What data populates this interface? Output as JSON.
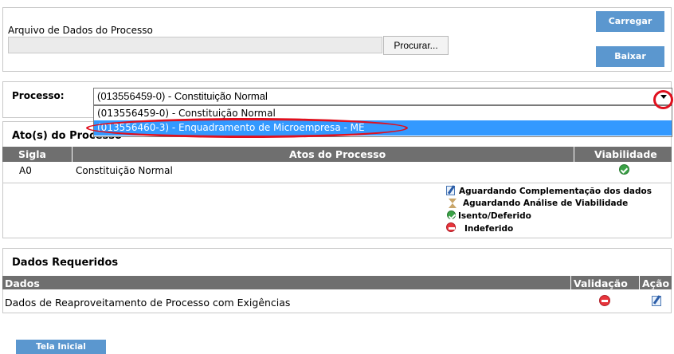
{
  "upload": {
    "label": "Arquivo de Dados do Processo",
    "file_value": "",
    "browse_label": "Procurar...",
    "load_label": "Carregar",
    "download_label": "Baixar"
  },
  "processo": {
    "label": "Processo:",
    "selected": "(013556459-0) - Constituição Normal",
    "options": [
      "(013556459-0) - Constituição Normal",
      "(013556460-3) - Enquadramento de Microempresa - ME"
    ],
    "highlighted_option_index": 1
  },
  "atos": {
    "title": "Ato(s) do Processo",
    "columns": [
      "Sigla",
      "Atos do Processo",
      "Viabilidade"
    ],
    "rows": [
      {
        "sigla": "A0",
        "ato": "Constituição Normal",
        "viabilidade_icon": "check-circle-icon"
      }
    ]
  },
  "legend": [
    {
      "icon": "edit-icon",
      "text": "Aguardando Complementação dos dados"
    },
    {
      "icon": "hourglass-icon",
      "text": "Aguardando Análise de Viabilidade"
    },
    {
      "icon": "check-circle-icon",
      "text": "Isento/Deferido"
    },
    {
      "icon": "minus-circle-icon",
      "text": "Indeferido"
    }
  ],
  "dados": {
    "title": "Dados Requeridos",
    "columns": [
      "Dados",
      "Validação",
      "Ação"
    ],
    "rows": [
      {
        "dado": "Dados de Reaproveitamento de Processo com Exigências",
        "validacao_icon": "minus-circle-icon",
        "acao_icon": "edit-icon"
      }
    ]
  },
  "footer": {
    "home_label": "Tela Inicial"
  },
  "colors": {
    "button_blue": "#5b97cf",
    "header_gray": "#6f6f6f",
    "highlight_blue": "#3399ff",
    "annotation_red": "#e0101e",
    "ok_green": "#3aa246",
    "deny_red": "#e8343b"
  }
}
